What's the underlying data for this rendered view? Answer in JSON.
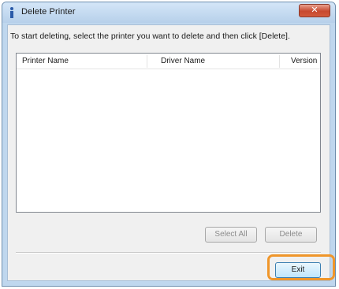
{
  "window": {
    "title": "Delete Printer",
    "close_label": "✕"
  },
  "instruction": "To start deleting, select the printer you want to delete and then click [Delete].",
  "list": {
    "columns": [
      "Printer Name",
      "Driver Name",
      "Version"
    ],
    "rows": []
  },
  "buttons": {
    "select_all": "Select All",
    "delete": "Delete",
    "exit": "Exit"
  },
  "colors": {
    "highlight": "#f0962a",
    "title_bar": "#bfd7ee",
    "close_button": "#c7492f"
  }
}
